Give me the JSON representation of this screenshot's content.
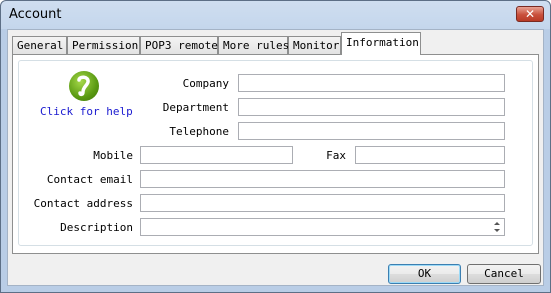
{
  "window": {
    "title": "Account",
    "close_label": "✕"
  },
  "tabs": [
    {
      "label": "General"
    },
    {
      "label": "Permission"
    },
    {
      "label": "POP3 remote"
    },
    {
      "label": "More rules"
    },
    {
      "label": "Monitor"
    },
    {
      "label": "Information",
      "active": true
    }
  ],
  "help": {
    "icon": "help-icon",
    "label": "Click for help"
  },
  "form": {
    "company": {
      "label": "Company",
      "value": ""
    },
    "department": {
      "label": "Department",
      "value": ""
    },
    "telephone": {
      "label": "Telephone",
      "value": ""
    },
    "mobile": {
      "label": "Mobile",
      "value": ""
    },
    "fax": {
      "label": "Fax",
      "value": ""
    },
    "contact_email": {
      "label": "Contact email",
      "value": ""
    },
    "contact_address": {
      "label": "Contact address",
      "value": ""
    },
    "description": {
      "label": "Description",
      "value": ""
    }
  },
  "buttons": {
    "ok": "OK",
    "cancel": "Cancel"
  }
}
